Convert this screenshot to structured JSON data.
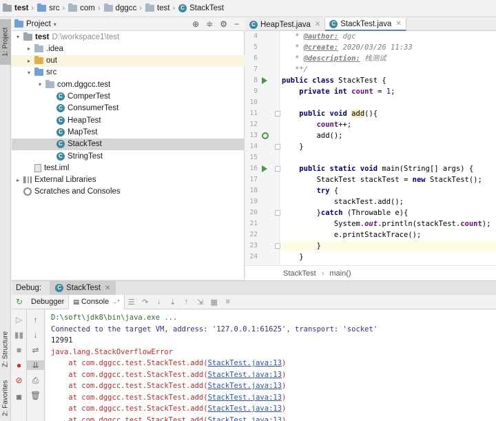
{
  "breadcrumbs": [
    "test",
    "src",
    "com",
    "dggcc",
    "test",
    "StackTest"
  ],
  "left_stripe": {
    "project_tab": "1: Project",
    "structure_tab": "Z: Structure",
    "favorites_tab": "2: Favorites"
  },
  "project_panel": {
    "title": "Project",
    "tree": [
      {
        "label": "test",
        "hint": "D:\\workspace1\\test",
        "indent": 0,
        "arrow": "▾",
        "icon": "folder-dark"
      },
      {
        "label": ".idea",
        "hint": "",
        "indent": 1,
        "arrow": "▸",
        "icon": "folder"
      },
      {
        "label": "out",
        "hint": "",
        "indent": 1,
        "arrow": "▸",
        "icon": "folder-yellow"
      },
      {
        "label": "src",
        "hint": "",
        "indent": 1,
        "arrow": "▾",
        "icon": "folder-blue"
      },
      {
        "label": "com.dggcc.test",
        "hint": "",
        "indent": 2,
        "arrow": "▾",
        "icon": "folder"
      },
      {
        "label": "ComperTest",
        "hint": "",
        "indent": 3,
        "arrow": "",
        "icon": "class"
      },
      {
        "label": "ConsumerTest",
        "hint": "",
        "indent": 3,
        "arrow": "",
        "icon": "class"
      },
      {
        "label": "HeapTest",
        "hint": "",
        "indent": 3,
        "arrow": "",
        "icon": "class"
      },
      {
        "label": "MapTest",
        "hint": "",
        "indent": 3,
        "arrow": "",
        "icon": "class"
      },
      {
        "label": "StackTest",
        "hint": "",
        "indent": 3,
        "arrow": "",
        "icon": "class",
        "selected": true
      },
      {
        "label": "StringTest",
        "hint": "",
        "indent": 3,
        "arrow": "",
        "icon": "class"
      },
      {
        "label": "test.iml",
        "hint": "",
        "indent": 1,
        "arrow": "",
        "icon": "file"
      },
      {
        "label": "External Libraries",
        "hint": "",
        "indent": 0,
        "arrow": "▸",
        "icon": "lib"
      },
      {
        "label": "Scratches and Consoles",
        "hint": "",
        "indent": 0,
        "arrow": "",
        "icon": "scratch"
      }
    ]
  },
  "editor_tabs": [
    {
      "label": "HeapTest.java",
      "active": false
    },
    {
      "label": "StackTest.java",
      "active": true
    }
  ],
  "editor": {
    "line_numbers": [
      "4",
      "5",
      "6",
      "7",
      "8",
      "9",
      "10",
      "11",
      "12",
      "13",
      "14",
      "15",
      "16",
      "17",
      "18",
      "19",
      "20",
      "21",
      "22",
      "23",
      "24"
    ],
    "breadcrumb": [
      "StackTest",
      "main()"
    ]
  },
  "debug": {
    "label": "Debug:",
    "session_tab": "StackTest",
    "subtabs": [
      "Debugger",
      "Console"
    ],
    "console_lines": [
      {
        "text": "D:\\soft\\jdk8\\bin\\java.exe ...",
        "kind": "cmd"
      },
      {
        "text": "Connected to the target VM, address: '127.0.0.1:61625', transport: 'socket'",
        "kind": "info"
      },
      {
        "text": "12991",
        "kind": "plain"
      },
      {
        "text": "java.lang.StackOverflowError",
        "kind": "err"
      }
    ],
    "stack_frame_prefix": "    at com.dggcc.test.StackTest.add(",
    "stack_frame_link": "StackTest.java:13",
    "stack_frame_suffix": ")",
    "stack_frame_count": 6
  },
  "colors": {
    "accent": "#4a88c7",
    "run_green": "#3d9a3d",
    "error_red": "#c82828",
    "selection": "#d5d5d5"
  }
}
